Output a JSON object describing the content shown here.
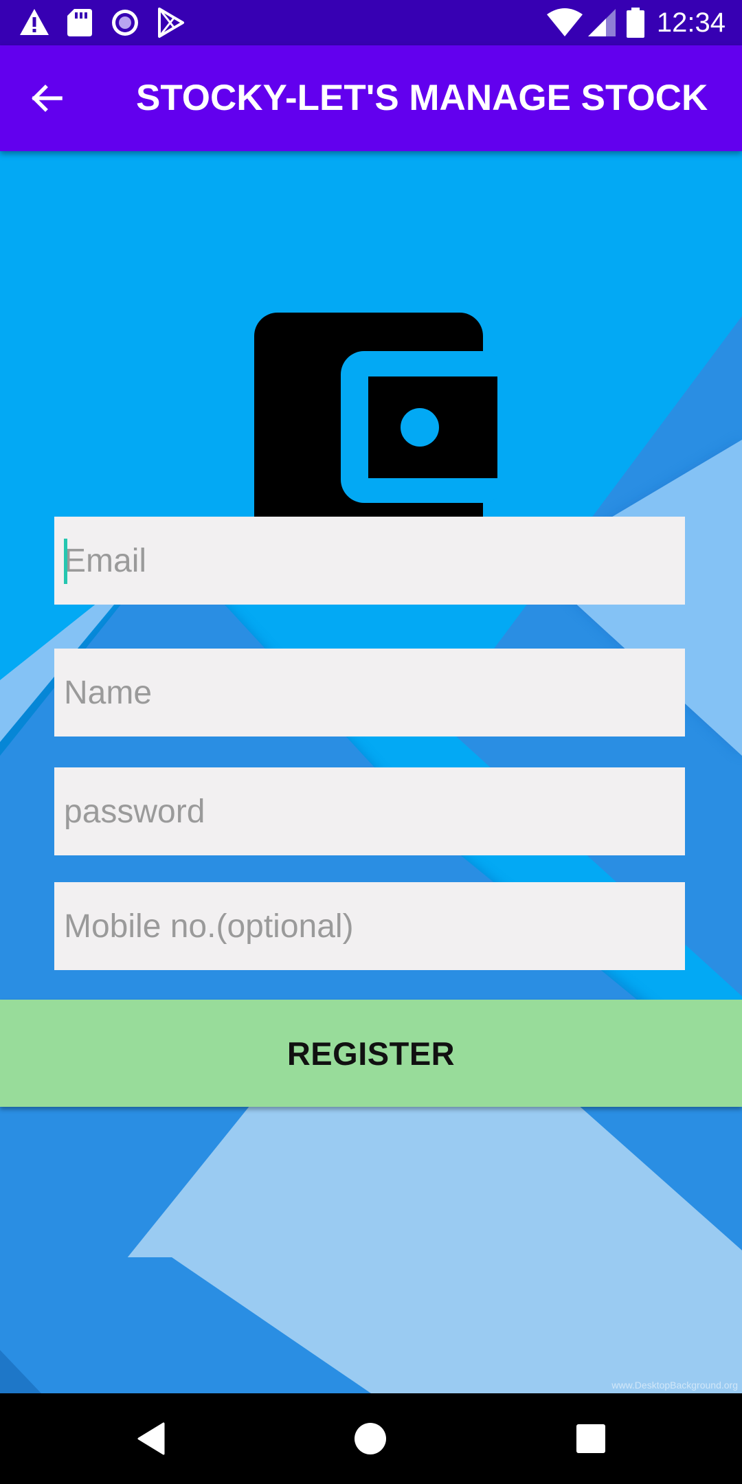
{
  "status_bar": {
    "time": "12:34",
    "left_icons": [
      "warning-icon",
      "sd-card-icon",
      "radio-button-icon",
      "play-store-icon"
    ],
    "right_icons": [
      "wifi-icon",
      "cell-signal-icon",
      "battery-icon"
    ]
  },
  "app_bar": {
    "title": "STOCKY-LET'S MANAGE STOCK",
    "back_icon": "arrow-back-icon",
    "color": "#6200ee"
  },
  "logo": {
    "icon": "wallet-icon"
  },
  "form": {
    "email_placeholder": "Email",
    "name_placeholder": "Name",
    "password_placeholder": "password",
    "mobile_placeholder": "Mobile no.(optional)",
    "register_label": "REGISTER"
  },
  "watermark": "www.DesktopBackground.org",
  "nav_bar": {
    "icons": [
      "nav-back-icon",
      "nav-home-icon",
      "nav-recents-icon"
    ]
  },
  "colors": {
    "status_bar": "#3700b3",
    "background": "#03a9f4",
    "register_button": "#98dc9a",
    "field_background": "#f2f0f1",
    "caret": "#26c6b0"
  }
}
